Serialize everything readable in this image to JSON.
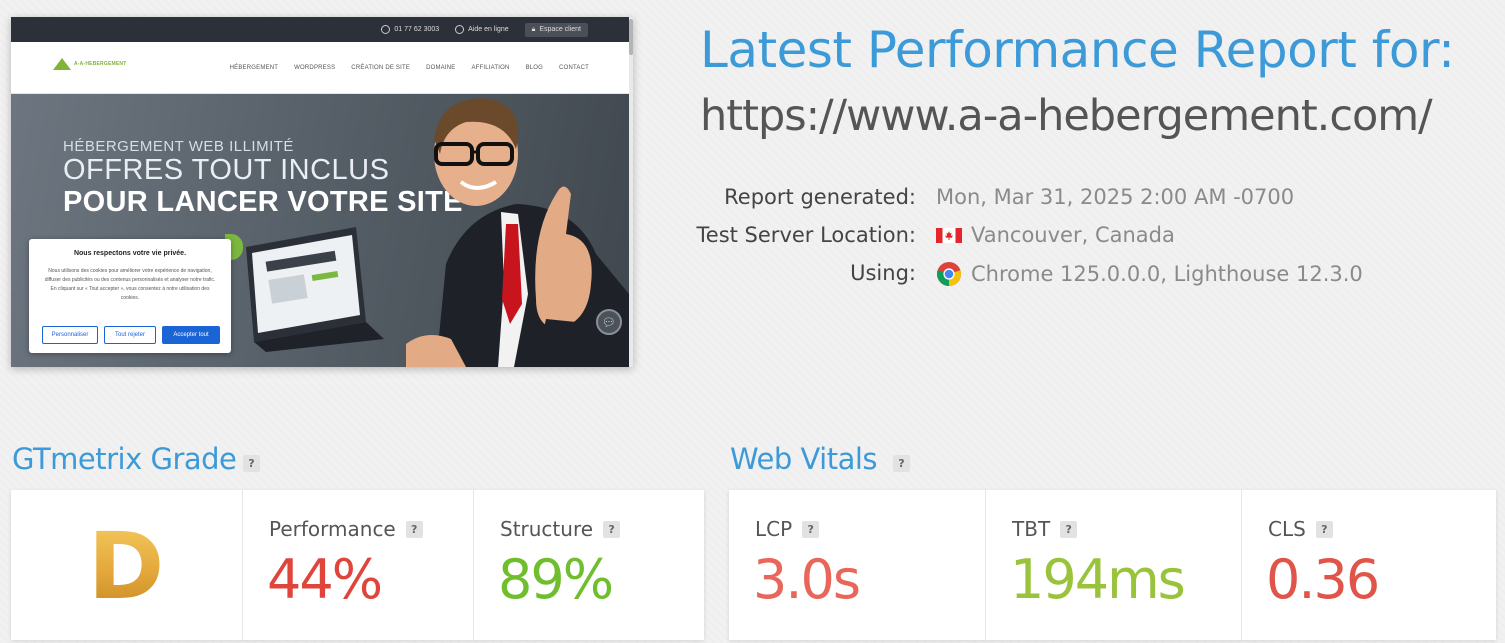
{
  "thumbnail": {
    "topbar": {
      "phone": "01 77 62 3003",
      "help": "Aide en ligne",
      "client": "Espace client"
    },
    "logo_text": "A-A-HEBERGEMENT",
    "menu": [
      "HÉBERGEMENT",
      "WORDPRESS",
      "CRÉATION DE SITE",
      "DOMAINE",
      "AFFILIATION",
      "BLOG",
      "CONTACT"
    ],
    "hero": {
      "subtitle": "HÉBERGEMENT WEB ILLIMITÉ",
      "line1": "OFFRES TOUT INCLUS",
      "line2": "POUR LANCER VOTRE SITE"
    },
    "cookie": {
      "title": "Nous respectons votre vie privée.",
      "text": "Nous utilisons des cookies pour améliorer votre expérience de navigation, diffuser des publicités ou des contenus personnalisés et analyser notre trafic. En cliquant sur « Tout accepter », vous consentez à notre utilisation des cookies.",
      "btn_customize": "Personnaliser",
      "btn_reject": "Tout rejeter",
      "btn_accept": "Accepter tout"
    }
  },
  "report": {
    "title": "Latest Performance Report for:",
    "url": "https://www.a-a-hebergement.com/",
    "generated_label": "Report generated:",
    "generated_value": "Mon, Mar 31, 2025 2:00 AM -0700",
    "location_label": "Test Server Location:",
    "location_value": "Vancouver, Canada",
    "using_label": "Using:",
    "using_value": "Chrome 125.0.0.0, Lighthouse 12.3.0"
  },
  "grade": {
    "title": "GTmetrix Grade",
    "letter": "D",
    "performance_label": "Performance",
    "performance_value": "44%",
    "structure_label": "Structure",
    "structure_value": "89%"
  },
  "vitals": {
    "title": "Web Vitals",
    "lcp_label": "LCP",
    "lcp_value": "3.0s",
    "tbt_label": "TBT",
    "tbt_value": "194ms",
    "cls_label": "CLS",
    "cls_value": "0.36"
  },
  "help_glyph": "?",
  "colors": {
    "title_blue": "#3d9ad8",
    "perf_red": "#e0453b",
    "structure_green": "#6fbe2e",
    "lcp_orange": "#e8665a",
    "tbt_green": "#98c33a",
    "cls_red": "#e0544a",
    "grade_gold": "#e3a73a"
  }
}
